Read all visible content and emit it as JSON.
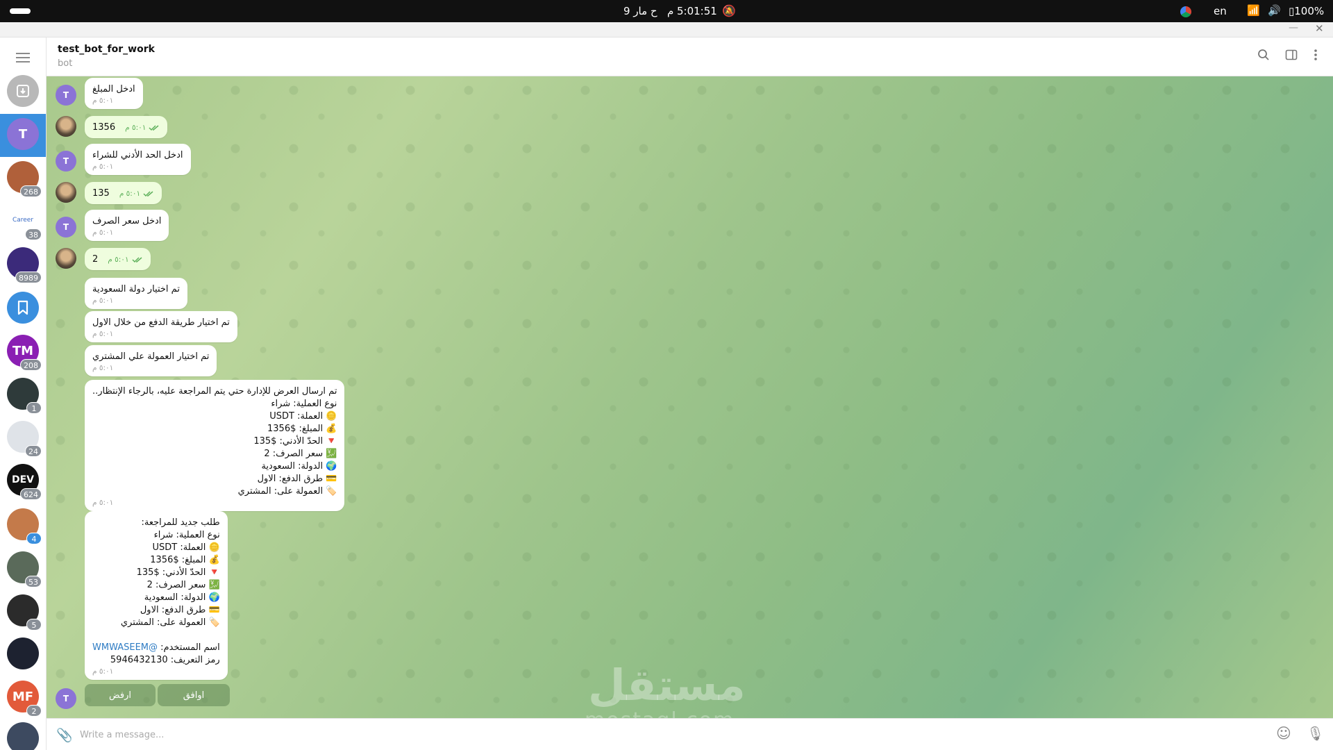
{
  "system": {
    "clock": "5:01:51 م",
    "date": "ح مار 9",
    "lang": "en",
    "battery": "100%",
    "mute_icon": "bell-off-icon",
    "wifi_icon": "wifi-icon",
    "volume_icon": "volume-icon"
  },
  "window": {
    "minimize": "—",
    "close": "✕"
  },
  "folders": [
    {
      "avatar": "",
      "badge": "",
      "kind": "archive-icon",
      "color": "#b8b8b8"
    },
    {
      "avatar": "T",
      "badge": "",
      "color": "#8b73d6",
      "active": true
    },
    {
      "avatar": "",
      "badge": "268",
      "color": "#b0603a"
    },
    {
      "avatar": "Career",
      "badge": "38",
      "color": "#ffffff"
    },
    {
      "avatar": "",
      "badge": "8989",
      "color": "#3b2a7a"
    },
    {
      "avatar": "",
      "badge": "",
      "kind": "bookmark-icon",
      "color": "#3a8fde"
    },
    {
      "avatar": "TM",
      "badge": "208",
      "color": "#8a1fb3"
    },
    {
      "avatar": "",
      "badge": "1",
      "color": "#2e3a3a"
    },
    {
      "avatar": "",
      "badge": "24",
      "color": "#dfe3e8"
    },
    {
      "avatar": "DEV",
      "badge": "624",
      "color": "#111111"
    },
    {
      "avatar": "",
      "badge": "4",
      "color": "#c47a4a",
      "badge_blue": true
    },
    {
      "avatar": "",
      "badge": "53",
      "color": "#5a6a5a"
    },
    {
      "avatar": "",
      "badge": "5",
      "color": "#2b2b2b"
    },
    {
      "avatar": "",
      "badge": "",
      "color": "#1d2230"
    },
    {
      "avatar": "MF",
      "badge": "2",
      "color": "#e25a3a"
    },
    {
      "avatar": "",
      "badge": "",
      "color": "#3d4a60"
    }
  ],
  "header": {
    "title": "test_bot_for_work",
    "subtitle": "bot"
  },
  "messages": [
    {
      "from": "bot",
      "text": "ادخل المبلغ",
      "time": "٥:٠١ م"
    },
    {
      "from": "me",
      "text": "1356",
      "time": "٥:٠١ م"
    },
    {
      "from": "bot",
      "text": "ادخل الحد الأدني للشراء",
      "time": "٥:٠١ م"
    },
    {
      "from": "me",
      "text": "135",
      "time": "٥:٠١ م"
    },
    {
      "from": "bot",
      "text": "ادخل سعر الصرف",
      "time": "٥:٠١ م"
    },
    {
      "from": "me",
      "text": "2",
      "time": "٥:٠١ م"
    },
    {
      "from": "bot",
      "text": "تم اختيار دولة السعودية",
      "time": "٥:٠١ م"
    },
    {
      "from": "bot",
      "text": "تم اختيار طريقة الدفع من خلال الاول",
      "time": "٥:٠١ م"
    },
    {
      "from": "bot",
      "text": "تم اختيار العمولة علي المشتري",
      "time": "٥:٠١ م"
    },
    {
      "from": "bot",
      "text": "تم ارسال العرض للإدارة حتي يتم المراجعة عليه، بالرجاء الإنتظار..\nنوع العملية: شراء\n🪙 العملة: USDT\n💰 المبلغ: $1356\n🔻 الحدّ الأدني: $135\n💹 سعر الصرف: 2\n🌍 الدولة: السعودية\n💳 طرق الدفع: الاول\n🏷️ العمولة على: المشتري",
      "time": "٥:٠١ م"
    },
    {
      "from": "bot",
      "text": "طلب جديد للمراجعة:\nنوع العملية: شراء\n🪙 العملة: USDT\n💰 المبلغ: $1356\n🔻 الحدّ الأدني: $135\n💹 سعر الصرف: 2\n🌍 الدولة: السعودية\n💳 طرق الدفع: الاول\n🏷️ العمولة على: المشتري\n\nاسم المستخدم: @WMWASEEM\nرمز التعريف: 5946432130",
      "time": "٥:٠١ م"
    }
  ],
  "keyboard": {
    "accept": "اوافق",
    "reject": "ارفض"
  },
  "bot_avatar": "T",
  "input": {
    "placeholder": "Write a message..."
  },
  "watermark": {
    "text": "مستقل",
    "url": "mostaql.com"
  }
}
